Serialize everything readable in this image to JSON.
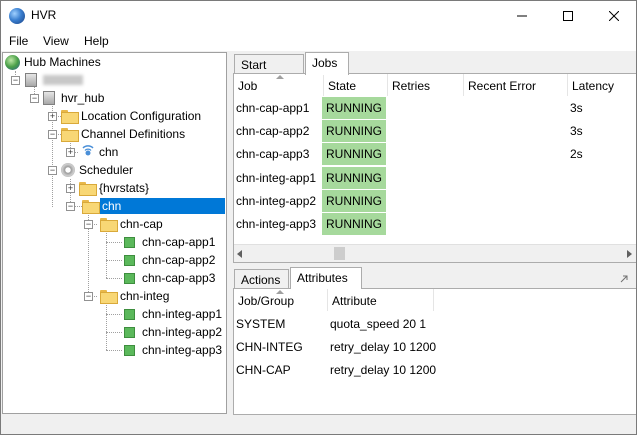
{
  "window": {
    "title": "HVR",
    "accent": "#0078d7",
    "running_color": "#a6d99c",
    "controls": {
      "minimize_icon": "minimize-icon",
      "maximize_icon": "maximize-icon",
      "close_icon": "close-icon"
    }
  },
  "menu": {
    "file": "File",
    "view": "View",
    "help": "Help"
  },
  "tree": {
    "root": "Hub Machines",
    "hub": "hvr_hub",
    "location_configuration": "Location Configuration",
    "channel_definitions": "Channel Definitions",
    "channel_chn": "chn",
    "scheduler": "Scheduler",
    "hvrstats": "{hvrstats}",
    "sched_chn": "chn",
    "group_cap": "chn-cap",
    "cap_jobs": [
      "chn-cap-app1",
      "chn-cap-app2",
      "chn-cap-app3"
    ],
    "group_integ": "chn-integ",
    "integ_jobs": [
      "chn-integ-app1",
      "chn-integ-app2",
      "chn-integ-app3"
    ]
  },
  "top_tabs": {
    "start_page": "Start Page",
    "jobs": "Jobs"
  },
  "jobs_table": {
    "columns": {
      "job": "Job",
      "state": "State",
      "retries": "Retries",
      "recent_error": "Recent Error",
      "latency": "Latency"
    },
    "rows": [
      {
        "job": "chn-cap-app1",
        "state": "RUNNING",
        "retries": "",
        "recent_error": "",
        "latency": "3s"
      },
      {
        "job": "chn-cap-app2",
        "state": "RUNNING",
        "retries": "",
        "recent_error": "",
        "latency": "3s"
      },
      {
        "job": "chn-cap-app3",
        "state": "RUNNING",
        "retries": "",
        "recent_error": "",
        "latency": "2s"
      },
      {
        "job": "chn-integ-app1",
        "state": "RUNNING",
        "retries": "",
        "recent_error": "",
        "latency": ""
      },
      {
        "job": "chn-integ-app2",
        "state": "RUNNING",
        "retries": "",
        "recent_error": "",
        "latency": ""
      },
      {
        "job": "chn-integ-app3",
        "state": "RUNNING",
        "retries": "",
        "recent_error": "",
        "latency": ""
      }
    ]
  },
  "bottom_tabs": {
    "actions": "Actions",
    "attributes": "Attributes"
  },
  "attributes_table": {
    "columns": {
      "job_group": "Job/Group",
      "attribute": "Attribute"
    },
    "rows": [
      {
        "job_group": "SYSTEM",
        "attribute": "quota_speed 20 1"
      },
      {
        "job_group": "CHN-INTEG",
        "attribute": "retry_delay 10 1200"
      },
      {
        "job_group": "CHN-CAP",
        "attribute": "retry_delay 10 1200"
      }
    ]
  }
}
